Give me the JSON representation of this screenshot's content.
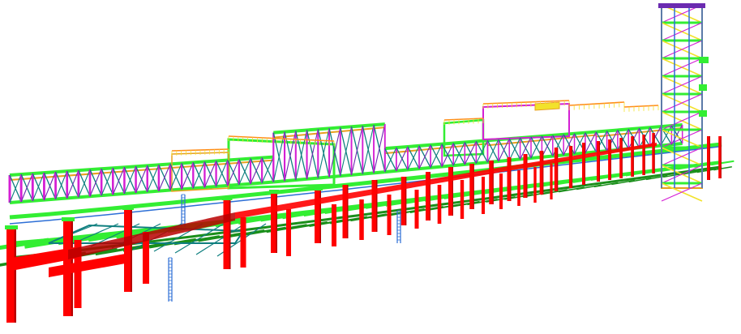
{
  "scene": {
    "kind": "3D structural steel model (pipe rack with tower)",
    "colors": {
      "background": "#ffffff",
      "columns": "#ff0000",
      "columns_dark": "#b80000",
      "beams_green": "#33ee33",
      "beams_green_dark": "#1a8f1a",
      "bracing_teal": "#0f7f7f",
      "bracing_magenta": "#d41fd4",
      "members_orange": "#e8a020",
      "members_yellow": "#f2e22b",
      "members_blue": "#2d6fd6",
      "members_purple": "#6b2bb0",
      "handrail_orange": "#ff8c1a"
    },
    "visible_components": [
      "lower-pipe-rack-columns",
      "lower-pipe-rack-beams",
      "upper-truss-deck",
      "cross-bracing",
      "access-ladders",
      "stair-tower",
      "handrails"
    ]
  }
}
